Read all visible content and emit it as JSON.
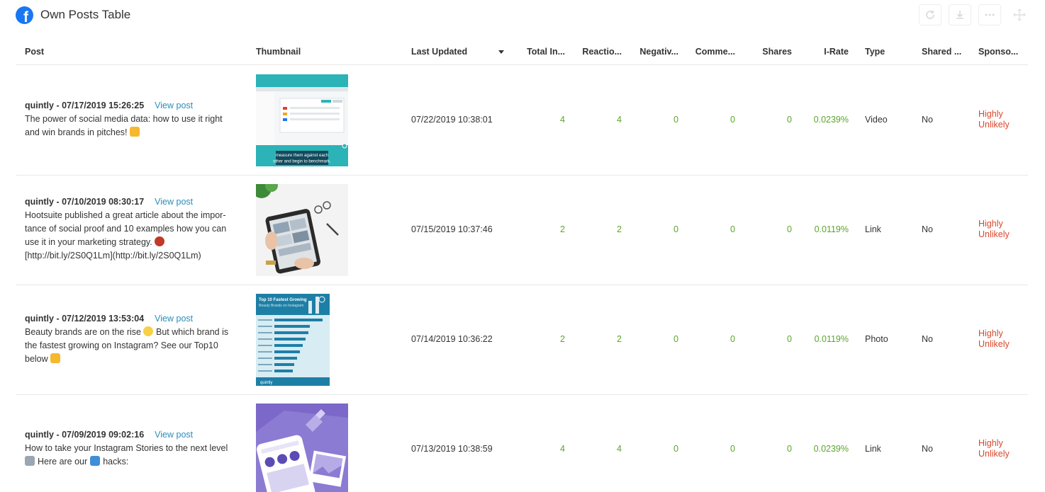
{
  "header": {
    "title": "Own Posts Table",
    "fb_icon_letter": "f"
  },
  "toolbar": {
    "refresh_icon": "refresh-icon",
    "download_icon": "download-icon",
    "more_icon": "more-icon",
    "move_icon": "move-icon"
  },
  "table": {
    "columns": [
      "Post",
      "Thumbnail",
      "Last Updated",
      "Total In...",
      "Reactio...",
      "Negativ...",
      "Comme...",
      "Shares",
      "I-Rate",
      "Type",
      "Shared ...",
      "Sponso..."
    ],
    "view_post_label": "View post",
    "rows": [
      {
        "author_date": "quintly - 07/17/2019 15:26:25",
        "text_lines": [
          "The power of social media data: how to use it right",
          "and win brands in pitches!"
        ],
        "emoji": "flexed-biceps",
        "thumb_caption": [
          "measure them against each",
          "other and begin to benchmark."
        ],
        "last_updated": "07/22/2019 10:38:01",
        "total": "4",
        "reactions": "4",
        "negative": "0",
        "comments": "0",
        "shares": "0",
        "irate": "0.0239%",
        "type": "Video",
        "shared": "No",
        "sponsored": [
          "Highly",
          "Unlikely"
        ]
      },
      {
        "author_date": "quintly - 07/10/2019 08:30:17",
        "text_lines": [
          "Hootsuite published a great article about the impor-",
          "tance of social proof and 10 examples how you can",
          "use it in your marketing strategy.",
          "[http://bit.ly/2S0Q1Lm](http://bit.ly/2S0Q1Lm)"
        ],
        "emoji": "drum",
        "last_updated": "07/15/2019 10:37:46",
        "total": "2",
        "reactions": "2",
        "negative": "0",
        "comments": "0",
        "shares": "0",
        "irate": "0.0119%",
        "type": "Link",
        "shared": "No",
        "sponsored": [
          "Highly",
          "Unlikely"
        ]
      },
      {
        "author_date": "quintly - 07/12/2019 13:53:04",
        "text_lines": [
          "Beauty brands are on the rise",
          "But which brand is",
          "the fastest growing on Instagram? See our Top10",
          "below"
        ],
        "emoji": "sparkles",
        "emoji2": "pointing-down",
        "thumb_title": "Top 10 Fastest Growing",
        "thumb_subtitle": "Beauty Brands on Instagram",
        "thumb_brand": "quintly",
        "last_updated": "07/14/2019 10:36:22",
        "total": "2",
        "reactions": "2",
        "negative": "0",
        "comments": "0",
        "shares": "0",
        "irate": "0.0119%",
        "type": "Photo",
        "shared": "No",
        "sponsored": [
          "Highly",
          "Unlikely"
        ]
      },
      {
        "author_date": "quintly - 07/09/2019 09:02:16",
        "text_lines": [
          "How to take your Instagram Stories to the next level",
          "Here are our",
          "hacks:"
        ],
        "emoji": "rocket",
        "emoji2": "keycap-6",
        "last_updated": "07/13/2019 10:38:59",
        "total": "4",
        "reactions": "4",
        "negative": "0",
        "comments": "0",
        "shares": "0",
        "irate": "0.0239%",
        "type": "Link",
        "shared": "No",
        "sponsored": [
          "Highly",
          "Unlikely"
        ]
      }
    ]
  },
  "colors": {
    "link": "#2a8ebb",
    "positive": "#5ca52a",
    "sponsor": "#d9472b",
    "facebook": "#1877f2"
  }
}
